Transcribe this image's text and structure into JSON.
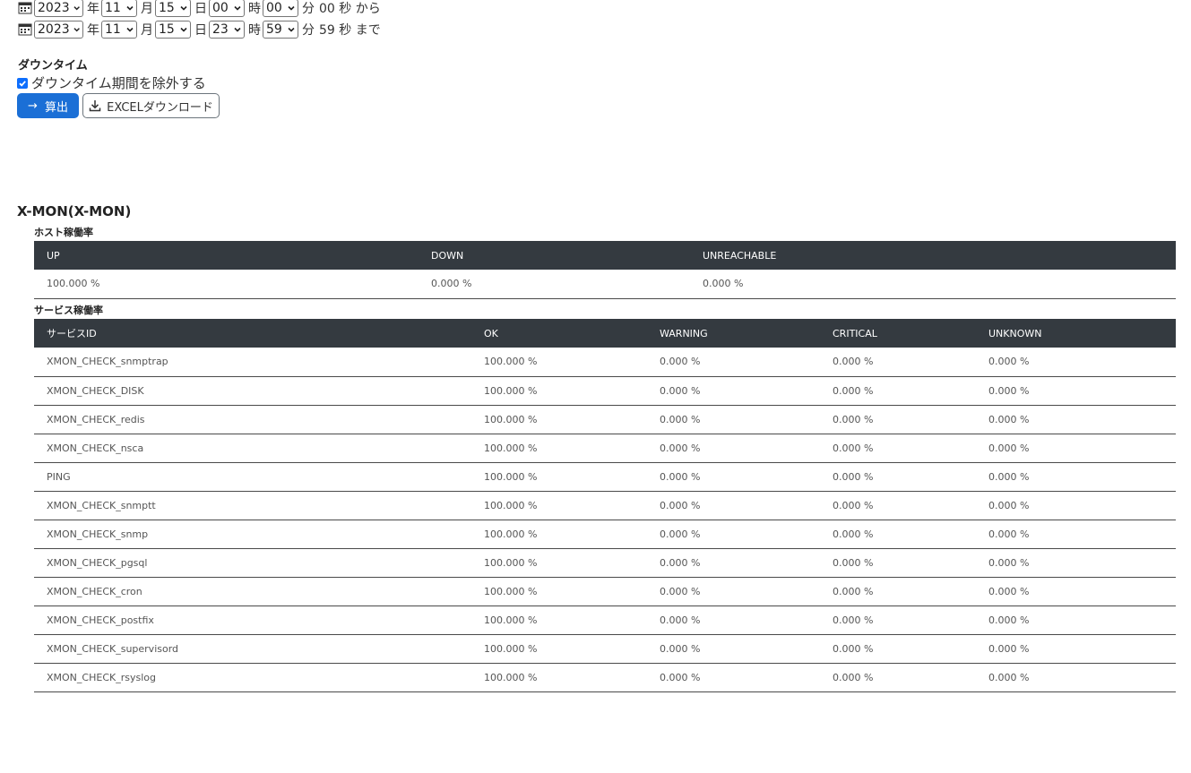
{
  "date_range": {
    "from": {
      "year": "2023",
      "year_unit": "年",
      "month": "11",
      "month_unit": "月",
      "day": "15",
      "day_unit": "日",
      "hour": "00",
      "hour_unit": "時",
      "minute": "00",
      "minute_unit": "分",
      "second_text": "00 秒 から"
    },
    "to": {
      "year": "2023",
      "year_unit": "年",
      "month": "11",
      "month_unit": "月",
      "day": "15",
      "day_unit": "日",
      "hour": "23",
      "hour_unit": "時",
      "minute": "59",
      "minute_unit": "分",
      "second_text": "59 秒 まで"
    },
    "icon": "calendar-icon"
  },
  "downtime": {
    "title": "ダウンタイム",
    "checkbox_label": "ダウンタイム期間を除外する",
    "checked": true
  },
  "buttons": {
    "calculate_label": "算出",
    "calculate_icon": "arrow-right-icon",
    "excel_label": "EXCELダウンロード",
    "excel_icon": "download-icon"
  },
  "colors": {
    "primary": "#1b6fd6",
    "table_header_bg": "#343a40",
    "checkbox": "#0d6efd"
  },
  "host": {
    "name": "X-MON(X-MON)",
    "host_rate_title": "ホスト稼働率",
    "host_columns": [
      "UP",
      "DOWN",
      "UNREACHABLE"
    ],
    "host_values": [
      "100.000 %",
      "0.000 %",
      "0.000 %"
    ],
    "service_rate_title": "サービス稼働率",
    "service_columns": [
      "サービスID",
      "OK",
      "WARNING",
      "CRITICAL",
      "UNKNOWN"
    ],
    "services": [
      [
        "XMON_CHECK_snmptrap",
        "100.000 %",
        "0.000 %",
        "0.000 %",
        "0.000 %"
      ],
      [
        "XMON_CHECK_DISK",
        "100.000 %",
        "0.000 %",
        "0.000 %",
        "0.000 %"
      ],
      [
        "XMON_CHECK_redis",
        "100.000 %",
        "0.000 %",
        "0.000 %",
        "0.000 %"
      ],
      [
        "XMON_CHECK_nsca",
        "100.000 %",
        "0.000 %",
        "0.000 %",
        "0.000 %"
      ],
      [
        "PING",
        "100.000 %",
        "0.000 %",
        "0.000 %",
        "0.000 %"
      ],
      [
        "XMON_CHECK_snmptt",
        "100.000 %",
        "0.000 %",
        "0.000 %",
        "0.000 %"
      ],
      [
        "XMON_CHECK_snmp",
        "100.000 %",
        "0.000 %",
        "0.000 %",
        "0.000 %"
      ],
      [
        "XMON_CHECK_pgsql",
        "100.000 %",
        "0.000 %",
        "0.000 %",
        "0.000 %"
      ],
      [
        "XMON_CHECK_cron",
        "100.000 %",
        "0.000 %",
        "0.000 %",
        "0.000 %"
      ],
      [
        "XMON_CHECK_postfix",
        "100.000 %",
        "0.000 %",
        "0.000 %",
        "0.000 %"
      ],
      [
        "XMON_CHECK_supervisord",
        "100.000 %",
        "0.000 %",
        "0.000 %",
        "0.000 %"
      ],
      [
        "XMON_CHECK_rsyslog",
        "100.000 %",
        "0.000 %",
        "0.000 %",
        "0.000 %"
      ]
    ]
  }
}
